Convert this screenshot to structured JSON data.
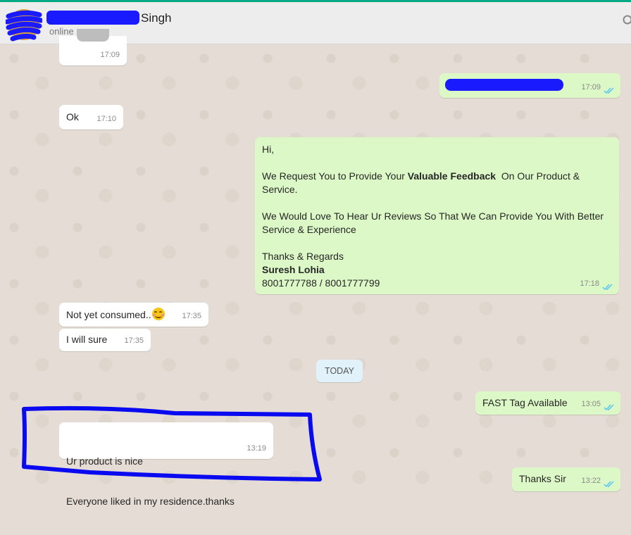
{
  "header": {
    "contact_name": "Singh",
    "status": "online"
  },
  "messages": [
    {
      "type": "in",
      "text": "",
      "time": "17:09"
    },
    {
      "type": "out",
      "text": "",
      "time": "17:09"
    },
    {
      "type": "in",
      "text": "Ok",
      "time": "17:10"
    },
    {
      "type": "out",
      "time": "17:18",
      "lines": {
        "l1": "Hi,",
        "l2a": "We Request You to Provide Your ",
        "l2b": "Valuable Feedback",
        "l2c": "  On Our Product &",
        "l3": "Service.",
        "l4": "We Would Love To Hear Ur Reviews So That We Can Provide You With Better",
        "l5": "Service & Experience",
        "l6": "Thanks & Regards",
        "l7": "Suresh Lohia",
        "l8": "8001777788 / 8001777799"
      }
    },
    {
      "type": "in",
      "text": "Not yet consumed..",
      "time": "17:35"
    },
    {
      "type": "in",
      "text": "I will sure",
      "time": "17:35"
    },
    {
      "type": "out",
      "text": "FAST Tag Available",
      "time": "13:05"
    },
    {
      "type": "in",
      "line1": "Ur product is nice",
      "line2": "Everyone liked in my residence.thanks",
      "time": "13:19"
    },
    {
      "type": "out",
      "text": "Thanks Sir",
      "time": "13:22"
    }
  ],
  "date_divider": "TODAY",
  "icons": {
    "read_ticks": "double-check-icon",
    "emoji": "smiling-face-emoji",
    "search": "search-icon"
  },
  "colors": {
    "incoming_bubble": "#ffffff",
    "outgoing_bubble": "#dcf8c6",
    "chat_background": "#e5ddd5",
    "tick_blue": "#4fc3f7",
    "redaction_ink": "#1a1aff"
  }
}
